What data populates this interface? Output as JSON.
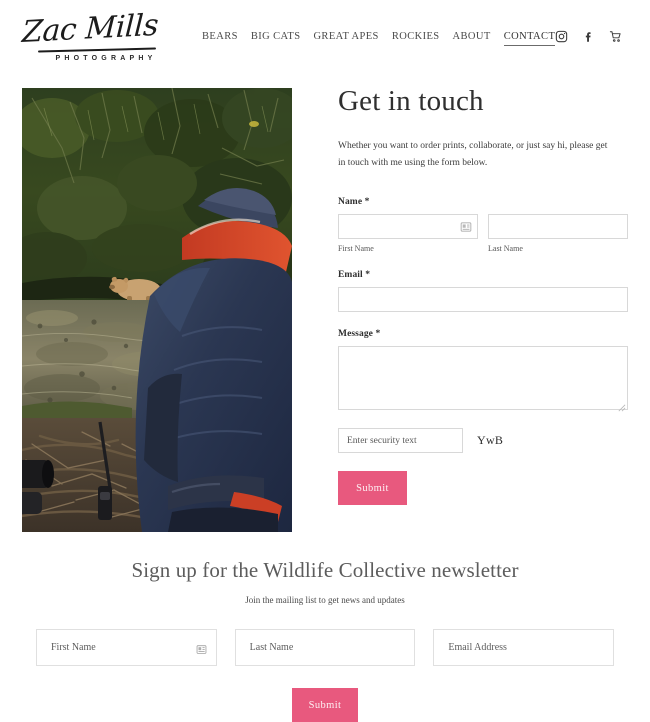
{
  "header": {
    "logo": {
      "script_text": "Zac Mills",
      "sub_text": "PHOTOGRAPHY"
    },
    "nav": [
      {
        "label": "BEARS",
        "active": false
      },
      {
        "label": "BIG CATS",
        "active": false
      },
      {
        "label": "GREAT APES",
        "active": false
      },
      {
        "label": "ROCKIES",
        "active": false
      },
      {
        "label": "ABOUT",
        "active": false
      },
      {
        "label": "CONTACT",
        "active": true
      }
    ],
    "icons": [
      {
        "name": "instagram-icon"
      },
      {
        "name": "facebook-icon"
      },
      {
        "name": "shopping-cart-icon"
      }
    ]
  },
  "photo": {
    "alt": "Photographer in navy jacket kneeling by a forest stream watching a spirit bear"
  },
  "contact": {
    "title": "Get in touch",
    "intro": "Whether you want to order prints, collaborate, or just say hi, please get in touch with me using the form below.",
    "name_label": "Name *",
    "first_name_sub": "First Name",
    "last_name_sub": "Last Name",
    "first_name_value": "",
    "last_name_value": "",
    "email_label": "Email *",
    "email_value": "",
    "message_label": "Message *",
    "message_value": "",
    "captcha_placeholder": "Enter security text",
    "captcha_value": "",
    "captcha_code": "YwB",
    "submit_label": "Submit"
  },
  "newsletter": {
    "title": "Sign up for the Wildlife Collective newsletter",
    "subtitle": "Join the mailing list to get news and updates",
    "first_name_placeholder": "First Name",
    "last_name_placeholder": "Last Name",
    "email_placeholder": "Email Address",
    "first_name_value": "",
    "last_name_value": "",
    "email_value": "",
    "submit_label": "Submit"
  },
  "colors": {
    "accent_pink": "#e8597e",
    "text": "#3a3a3a",
    "border": "#d8d8d8"
  }
}
